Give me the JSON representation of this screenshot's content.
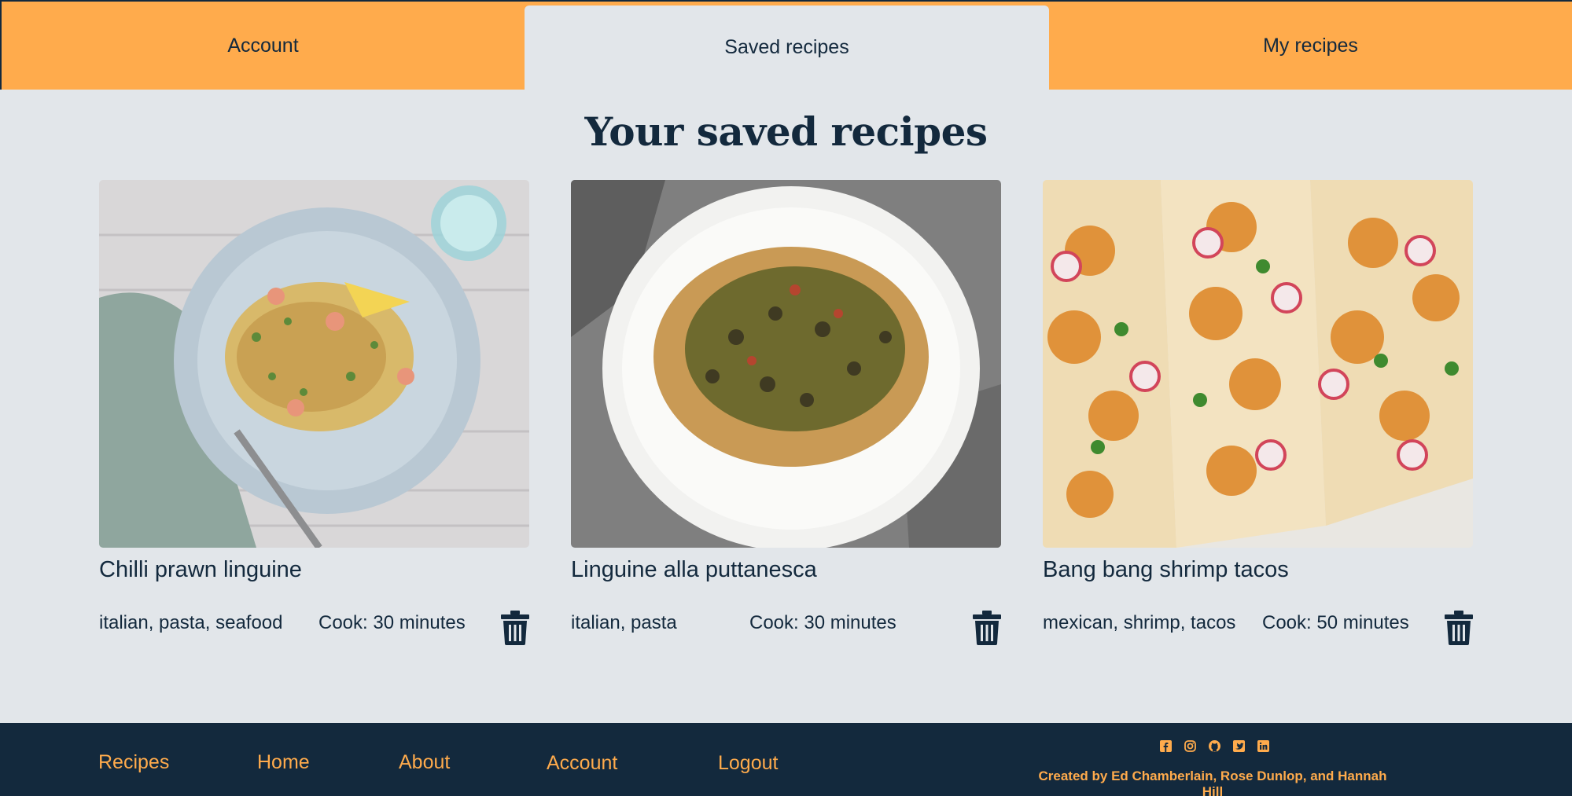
{
  "tabs": [
    {
      "label": "Account",
      "active": false
    },
    {
      "label": "Saved recipes",
      "active": true
    },
    {
      "label": "My recipes",
      "active": false
    }
  ],
  "page_title": "Your saved recipes",
  "recipes": [
    {
      "title": "Chilli prawn linguine",
      "tags": "italian, pasta, seafood",
      "cook": "Cook: 30 minutes"
    },
    {
      "title": "Linguine alla puttanesca",
      "tags": "italian, pasta",
      "cook": "Cook: 30 minutes"
    },
    {
      "title": "Bang bang shrimp tacos",
      "tags": "mexican, shrimp, tacos",
      "cook": "Cook: 50 minutes"
    }
  ],
  "footer": {
    "links": [
      "Recipes",
      "Home",
      "About",
      "Account",
      "Logout"
    ],
    "social_icons": [
      "facebook-icon",
      "instagram-icon",
      "github-icon",
      "twitter-icon",
      "linkedin-icon"
    ],
    "credits": "Created by Ed Chamberlain, Rose Dunlop, and Hannah Hill"
  },
  "colors": {
    "accent": "#ffab4c",
    "navy": "#13293d",
    "background": "#e2e6ea"
  }
}
